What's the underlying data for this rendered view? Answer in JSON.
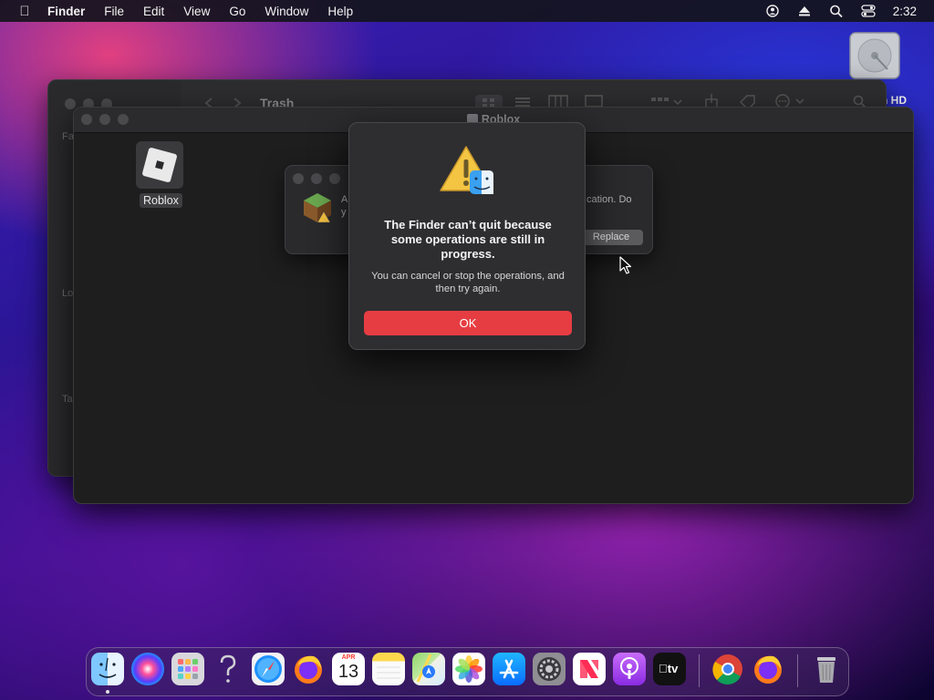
{
  "menubar": {
    "app_name": "Finder",
    "items": [
      "File",
      "Edit",
      "View",
      "Go",
      "Window",
      "Help"
    ],
    "clock": "2:32",
    "status_icons": [
      "user-icon",
      "eject-icon",
      "search-icon",
      "control-center-icon"
    ]
  },
  "desktop": {
    "hd_label": "h HD"
  },
  "trash_window": {
    "title": "Trash",
    "sidebar_headings": [
      "Fa",
      "Lo",
      "Ta"
    ]
  },
  "roblox_window": {
    "title": "Roblox",
    "file_label": "Roblox"
  },
  "copy_dialog": {
    "text_line1": "A",
    "text_line2": "y",
    "text_right": "cation. Do",
    "replace_label": "Replace"
  },
  "alert": {
    "title": "The Finder can’t quit because some operations are still in progress.",
    "message": "You can cancel or stop the operations, and then try again.",
    "ok_label": "OK"
  },
  "dock": {
    "items": [
      "finder-icon",
      "siri-icon",
      "launchpad-icon",
      "help-icon",
      "safari-icon",
      "firefox-icon",
      "calendar-icon",
      "notes-icon",
      "maps-icon",
      "photos-icon",
      "app-store-icon",
      "system-preferences-icon",
      "news-icon",
      "podcasts-icon",
      "apple-tv-icon",
      "chrome-icon",
      "firefox-icon",
      "trash-icon"
    ],
    "calendar_month": "APR",
    "calendar_day": "13",
    "tv_label": "tv"
  }
}
